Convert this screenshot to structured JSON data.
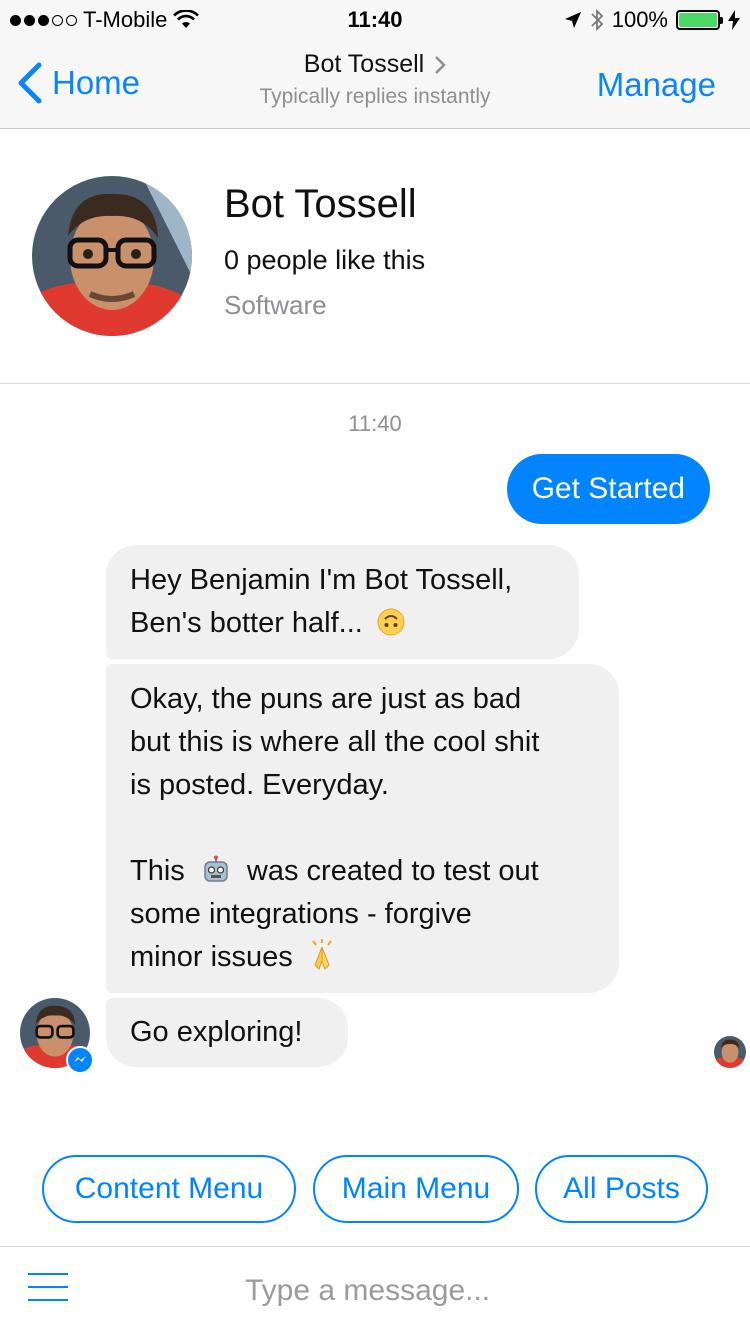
{
  "status_bar": {
    "carrier": "T-Mobile",
    "time": "11:40",
    "battery": "100%",
    "icons": [
      "signal-dots-icon",
      "wifi-icon",
      "location-arrow-icon",
      "bluetooth-icon",
      "battery-icon",
      "charging-bolt-icon"
    ]
  },
  "nav": {
    "back_label": "Home",
    "title": "Bot Tossell",
    "subtitle": "Typically replies instantly",
    "manage_label": "Manage",
    "accent": "#0A84FF"
  },
  "profile": {
    "name": "Bot Tossell",
    "likes": "0 people like this",
    "category": "Software"
  },
  "chat": {
    "timestamp": "11:40",
    "outgoing_message": "Get Started",
    "incoming": {
      "m1_line1": "Hey Benjamin I'm Bot Tossell,",
      "m1_line2": "Ben's botter half...",
      "m2_line1": "Okay, the puns are just as bad",
      "m2_line2": "but this is where all the cool shit",
      "m2_line3": "is posted. Everyday.",
      "m2_line4_pre": "This",
      "m2_line4_post": "was created to test out",
      "m2_line5": "some integrations - forgive",
      "m2_line6": "minor issues",
      "m3": "Go exploring!"
    },
    "emoji_icons": [
      "upside-down-face-icon",
      "robot-face-icon",
      "folded-hands-icon"
    ],
    "bubble_color": "#F1F0F0",
    "outgoing_color": "#0084FF"
  },
  "quick_replies": [
    "Content Menu",
    "Main Menu",
    "All Posts"
  ],
  "composer": {
    "placeholder": "Type a message..."
  }
}
